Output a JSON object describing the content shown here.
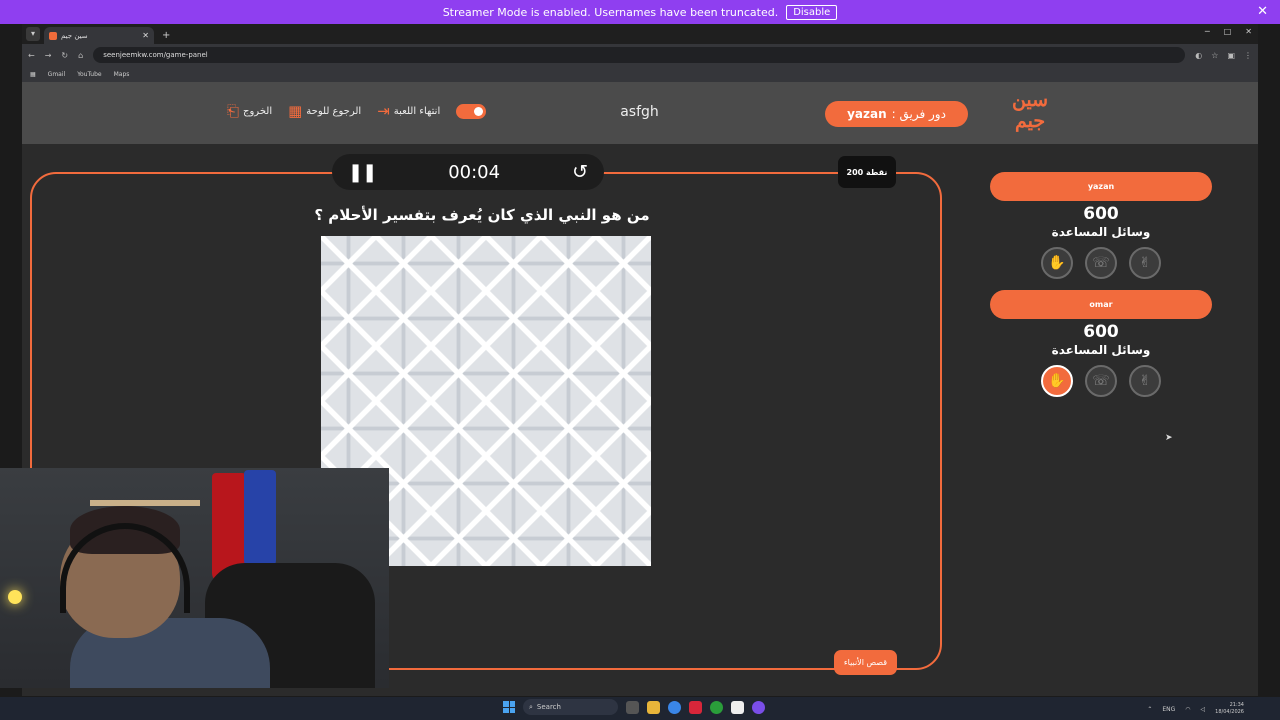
{
  "banner": {
    "text": "Streamer Mode is enabled. Usernames have been truncated.",
    "button": "Disable",
    "close": "✕"
  },
  "browser": {
    "tab_title": "سين جيم",
    "url": "seenjeemkw.com/game-panel",
    "bookmarks": [
      "Gmail",
      "YouTube",
      "Maps"
    ]
  },
  "header": {
    "logo_line1": "سين",
    "logo_line2": "جيم",
    "turn_label": "دور فريق :",
    "turn_team": "yazan",
    "game_name": "asfgh",
    "nav": {
      "end_game": "انتهاء اللعبة",
      "back_board": "الرجوع للوحة",
      "exit": "الخروج"
    }
  },
  "question": {
    "timer": "00:04",
    "points": "200 نقطة",
    "text": "من هو النبي الذي كان يُعرف بتفسير الأحلام ؟",
    "category": "قصص الأنبياء"
  },
  "teams": [
    {
      "name": "yazan",
      "score": "600",
      "aids_label": "وسائل المساعدة",
      "aids": [
        {
          "icon": "hand-icon",
          "active": false
        },
        {
          "icon": "phone-icon",
          "active": false
        },
        {
          "icon": "two-fingers-icon",
          "active": false
        }
      ]
    },
    {
      "name": "omar",
      "score": "600",
      "aids_label": "وسائل المساعدة",
      "aids": [
        {
          "icon": "hand-icon",
          "active": true
        },
        {
          "icon": "phone-icon",
          "active": false
        },
        {
          "icon": "two-fingers-icon",
          "active": false
        }
      ]
    }
  ],
  "taskbar": {
    "search": "Search",
    "lang": "ENG",
    "time": "21:34",
    "date": "18/04/2026"
  },
  "colors": {
    "accent": "#f26b3d",
    "banner": "#8f3ff0",
    "header": "#4b4b4b",
    "panel": "#2b2b2b"
  }
}
